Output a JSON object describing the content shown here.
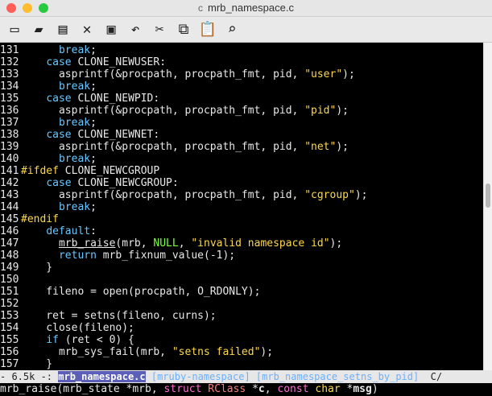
{
  "window": {
    "title": "mrb_namespace.c"
  },
  "colors": {
    "close": "#ff5f56",
    "minimize": "#ffbd2e",
    "maximize": "#27c93f"
  },
  "toolbar": {
    "buttons": [
      {
        "name": "new-file-button",
        "icon": "page-icon",
        "glyph": "▭"
      },
      {
        "name": "open-file-button",
        "icon": "folder-icon",
        "glyph": "▰"
      },
      {
        "name": "dired-button",
        "icon": "cabinet-icon",
        "glyph": "▤"
      },
      {
        "name": "kill-buffer-button",
        "icon": "close-icon",
        "glyph": "✕"
      },
      {
        "name": "save-button",
        "icon": "disk-icon",
        "glyph": "▣"
      },
      {
        "name": "undo-button",
        "icon": "undo-icon",
        "glyph": "↶"
      },
      {
        "name": "cut-button",
        "icon": "scissors-icon",
        "glyph": "✂"
      },
      {
        "name": "copy-button",
        "icon": "copy-icon",
        "glyph": "⧉"
      },
      {
        "name": "paste-button",
        "icon": "clipboard-icon",
        "glyph": "📋"
      },
      {
        "name": "search-button",
        "icon": "search-icon",
        "glyph": "⌕"
      }
    ]
  },
  "code": [
    {
      "n": "131",
      "segs": [
        [
          "      ",
          ""
        ],
        [
          "break",
          "kw"
        ],
        [
          ";",
          ""
        ]
      ]
    },
    {
      "n": "132",
      "segs": [
        [
          "    ",
          ""
        ],
        [
          "case",
          "kw"
        ],
        [
          " CLONE_NEWUSER:",
          ""
        ]
      ]
    },
    {
      "n": "133",
      "segs": [
        [
          "      asprintf(&procpath, procpath_fmt, pid, ",
          ""
        ],
        [
          "\"user\"",
          "st"
        ],
        [
          ");",
          ""
        ]
      ]
    },
    {
      "n": "134",
      "segs": [
        [
          "      ",
          ""
        ],
        [
          "break",
          "kw"
        ],
        [
          ";",
          ""
        ]
      ]
    },
    {
      "n": "135",
      "segs": [
        [
          "    ",
          ""
        ],
        [
          "case",
          "kw"
        ],
        [
          " CLONE_NEWPID:",
          ""
        ]
      ]
    },
    {
      "n": "136",
      "segs": [
        [
          "      asprintf(&procpath, procpath_fmt, pid, ",
          ""
        ],
        [
          "\"pid\"",
          "st"
        ],
        [
          ");",
          ""
        ]
      ]
    },
    {
      "n": "137",
      "segs": [
        [
          "      ",
          ""
        ],
        [
          "break",
          "kw"
        ],
        [
          ";",
          ""
        ]
      ]
    },
    {
      "n": "138",
      "segs": [
        [
          "    ",
          ""
        ],
        [
          "case",
          "kw"
        ],
        [
          " CLONE_NEWNET:",
          ""
        ]
      ]
    },
    {
      "n": "139",
      "segs": [
        [
          "      asprintf(&procpath, procpath_fmt, pid, ",
          ""
        ],
        [
          "\"net\"",
          "st"
        ],
        [
          ");",
          ""
        ]
      ]
    },
    {
      "n": "140",
      "segs": [
        [
          "      ",
          ""
        ],
        [
          "break",
          "kw"
        ],
        [
          ";",
          ""
        ]
      ]
    },
    {
      "n": "141",
      "segs": [
        [
          "",
          ""
        ],
        [
          "#ifdef",
          "pp"
        ],
        [
          " CLONE_NEWCGROUP",
          ""
        ]
      ]
    },
    {
      "n": "142",
      "segs": [
        [
          "    ",
          ""
        ],
        [
          "case",
          "kw"
        ],
        [
          " CLONE_NEWCGROUP:",
          ""
        ]
      ]
    },
    {
      "n": "143",
      "segs": [
        [
          "      asprintf(&procpath, procpath_fmt, pid, ",
          ""
        ],
        [
          "\"cgroup\"",
          "st"
        ],
        [
          ");",
          ""
        ]
      ]
    },
    {
      "n": "144",
      "segs": [
        [
          "      ",
          ""
        ],
        [
          "break",
          "kw"
        ],
        [
          ";",
          ""
        ]
      ]
    },
    {
      "n": "145",
      "segs": [
        [
          "",
          ""
        ],
        [
          "#endif",
          "pp"
        ]
      ]
    },
    {
      "n": "146",
      "segs": [
        [
          "    ",
          ""
        ],
        [
          "default",
          "kw"
        ],
        [
          ":",
          ""
        ]
      ]
    },
    {
      "n": "147",
      "segs": [
        [
          "      ",
          ""
        ],
        [
          "mrb_raise",
          "ul"
        ],
        [
          "(mrb, ",
          ""
        ],
        [
          "NULL",
          "cn"
        ],
        [
          ", ",
          ""
        ],
        [
          "\"invalid namespace id\"",
          "st"
        ],
        [
          ");",
          ""
        ]
      ]
    },
    {
      "n": "148",
      "segs": [
        [
          "      ",
          ""
        ],
        [
          "return",
          "kw"
        ],
        [
          " mrb_fixnum_value(-1);",
          ""
        ]
      ]
    },
    {
      "n": "149",
      "segs": [
        [
          "    }",
          ""
        ]
      ]
    },
    {
      "n": "150",
      "segs": [
        [
          "",
          ""
        ]
      ]
    },
    {
      "n": "151",
      "segs": [
        [
          "    fileno = open(procpath, O_RDONLY);",
          ""
        ]
      ]
    },
    {
      "n": "152",
      "segs": [
        [
          "",
          ""
        ]
      ]
    },
    {
      "n": "153",
      "segs": [
        [
          "    ret = setns(fileno, curns);",
          ""
        ]
      ]
    },
    {
      "n": "154",
      "segs": [
        [
          "    close(fileno);",
          ""
        ]
      ]
    },
    {
      "n": "155",
      "segs": [
        [
          "    ",
          ""
        ],
        [
          "if",
          "kw"
        ],
        [
          " (ret < 0) {",
          ""
        ]
      ]
    },
    {
      "n": "156",
      "segs": [
        [
          "      mrb_sys_fail(mrb, ",
          ""
        ],
        [
          "\"setns failed\"",
          "st"
        ],
        [
          ");",
          ""
        ]
      ]
    },
    {
      "n": "157",
      "segs": [
        [
          "    }",
          ""
        ]
      ]
    }
  ],
  "modeline": {
    "left": "- 6.5k -: ",
    "buffer": "mrb_namespace.c",
    "project": "[mruby-namespace]",
    "function": "[mrb_namespace_setns_by_pid]",
    "mode": "C/"
  },
  "echo": {
    "segs": [
      [
        "mrb_raise(mrb_state *mrb, ",
        ""
      ],
      [
        "struct",
        "ty"
      ],
      [
        " ",
        ""
      ],
      [
        "RClass",
        "cls"
      ],
      [
        " *",
        ""
      ],
      [
        "c",
        "var"
      ],
      [
        ", ",
        ""
      ],
      [
        "const",
        "ty"
      ],
      [
        " ",
        ""
      ],
      [
        "char",
        "kw2"
      ],
      [
        " *",
        ""
      ],
      [
        "msg",
        "var"
      ],
      [
        ")",
        ""
      ]
    ]
  }
}
